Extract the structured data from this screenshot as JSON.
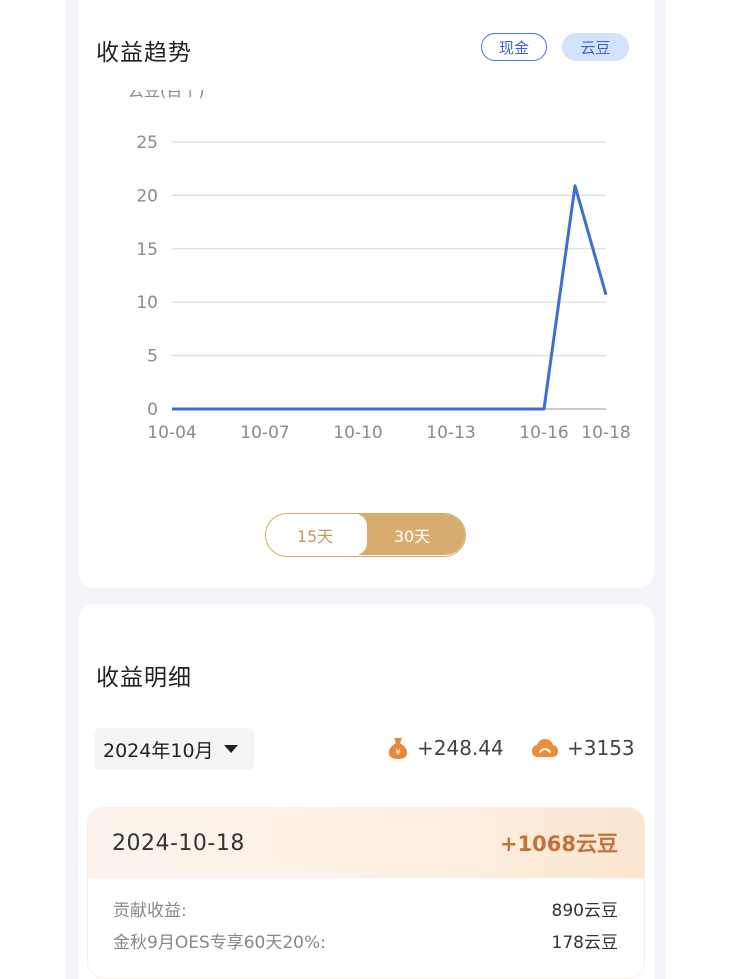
{
  "trend": {
    "title": "收益趋势",
    "toggle_cash": "现金",
    "toggle_bean": "云豆",
    "period_15": "15天",
    "period_30": "30天"
  },
  "chart_data": {
    "type": "line",
    "ylabel": "云豆(百个)",
    "ylim": [
      0,
      25
    ],
    "yticks": [
      "0",
      "5",
      "10",
      "15",
      "20",
      "25"
    ],
    "xticks": [
      "10-04",
      "10-07",
      "10-10",
      "10-13",
      "10-16",
      "10-18"
    ],
    "x": [
      "10-04",
      "10-05",
      "10-06",
      "10-07",
      "10-08",
      "10-09",
      "10-10",
      "10-11",
      "10-12",
      "10-13",
      "10-14",
      "10-15",
      "10-16",
      "10-17",
      "10-18"
    ],
    "series": [
      {
        "values": [
          0,
          0,
          0,
          0,
          0,
          0,
          0,
          0,
          0,
          0,
          0,
          0,
          0,
          20.9,
          10.7
        ]
      }
    ],
    "grid": true,
    "colors": {
      "line": "#3b6fd4",
      "grid": "#dcdcdc",
      "axis": "#aaaaaa",
      "tick": "#8a8a8a"
    }
  },
  "detail": {
    "title": "收益明细",
    "month": "2024年10月",
    "cash_total": "+248.44",
    "bean_total": "+3153",
    "cash_icon": "money-bag-icon",
    "bean_icon": "cloud-bean-icon",
    "day": {
      "date": "2024-10-18",
      "total": "+1068云豆",
      "rows": [
        {
          "label": "贡献收益:",
          "value": "890云豆"
        },
        {
          "label": "金秋9月OES专享60天20%:",
          "value": "178云豆"
        }
      ]
    }
  }
}
